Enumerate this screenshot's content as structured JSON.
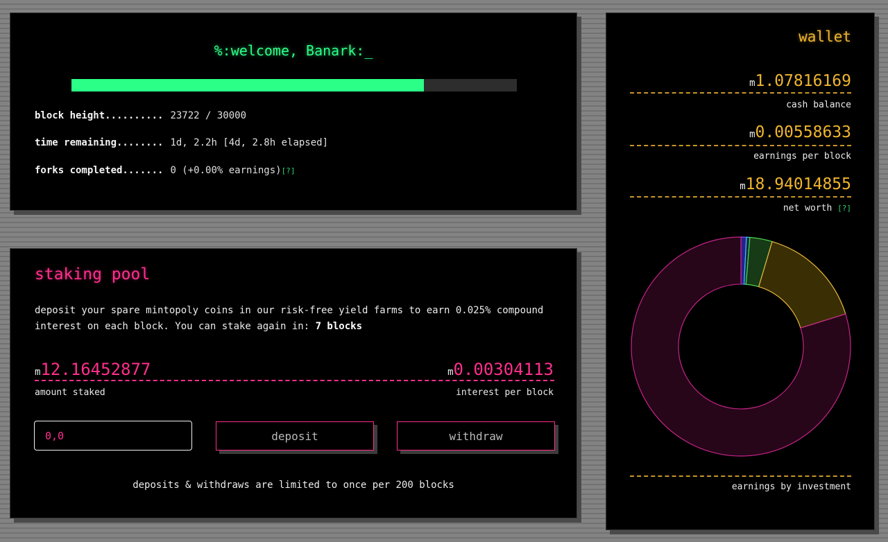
{
  "welcome": {
    "title": "%:welcome, Banark:_",
    "progress_fraction": 0.79073,
    "stats": [
      {
        "label": "block height..........",
        "value": "23722 / 30000",
        "help": ""
      },
      {
        "label": "time remaining........",
        "value": "1d, 2.2h [4d, 2.8h elapsed]",
        "help": ""
      },
      {
        "label": "forks completed.......",
        "value": "0 (+0.00% earnings)",
        "help": "[?]"
      }
    ],
    "colors": {
      "accent": "#2bff88"
    }
  },
  "staking": {
    "title": "staking pool",
    "desc_prefix": "deposit your spare mintopoly coins in our risk-free yield farms to earn 0.025% compound interest on each block. You can stake again in: ",
    "desc_bold": "7 blocks",
    "amount_unit": "m",
    "amount_value": "12.16452877",
    "amount_label": "amount staked",
    "interest_unit": "m",
    "interest_value": "0.00304113",
    "interest_label": "interest per block",
    "input_value": "0,0",
    "deposit_label": "deposit",
    "withdraw_label": "withdraw",
    "note": "deposits & withdraws are limited to once per 200 blocks",
    "colors": {
      "accent": "#ff2f8c"
    }
  },
  "wallet": {
    "title": "wallet",
    "entries": [
      {
        "unit": "m",
        "value": "1.07816169",
        "label": "cash balance",
        "help": ""
      },
      {
        "unit": "m",
        "value": "0.00558633",
        "label": "earnings per block",
        "help": ""
      },
      {
        "unit": "m",
        "value": "18.94014855",
        "label": "net worth",
        "help": "[?]"
      }
    ],
    "chart_label": "earnings by investment",
    "colors": {
      "accent": "#f0b52e"
    }
  },
  "chart_data": {
    "type": "pie",
    "title": "",
    "slices": [
      {
        "value": 0.8,
        "fill": "#2a1f8a",
        "stroke": "#7b5cff"
      },
      {
        "value": 0.5,
        "fill": "#0d2a3a",
        "stroke": "#3ac8ff"
      },
      {
        "value": 3.3,
        "fill": "#173a17",
        "stroke": "#49d650"
      },
      {
        "value": 15.6,
        "fill": "#3a2e05",
        "stroke": "#e8b83a"
      },
      {
        "value": 79.8,
        "fill": "#260618",
        "stroke": "#c8238a"
      }
    ],
    "inner_radius_ratio": 0.57
  }
}
